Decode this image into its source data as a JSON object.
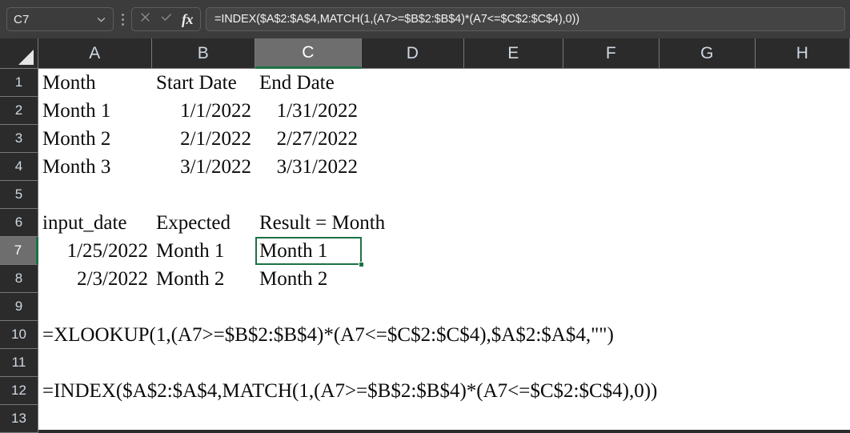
{
  "toolbar": {
    "name_box_value": "C7",
    "name_box_icon": "chevron-down-icon",
    "overflow_icon": "kebab-menu-icon",
    "cancel_icon": "close-icon",
    "accept_icon": "check-icon",
    "function_icon": "fx-icon",
    "function_icon_label": "fx",
    "formula_value": "=INDEX($A$2:$A$4,MATCH(1,(A7>=$B$2:$B$4)*(A7<=$C$2:$C$4),0))"
  },
  "grid": {
    "active_column": "C",
    "active_row": "7",
    "selected_cell": "C7",
    "accent_color": "#1e7145",
    "header_background": "#2b2b2b",
    "header_active_background": "#6e6e6e",
    "sheet_background": "#ffffff",
    "columns": [
      "A",
      "B",
      "C",
      "D",
      "E",
      "F",
      "G",
      "H"
    ],
    "rows": [
      "1",
      "2",
      "3",
      "4",
      "5",
      "6",
      "7",
      "8",
      "9",
      "10",
      "11",
      "12",
      "13"
    ]
  },
  "cells": {
    "A1": "Month",
    "B1": "Start Date",
    "C1": "End Date",
    "A2": "Month 1",
    "B2": "1/1/2022",
    "C2": "1/31/2022",
    "A3": "Month 2",
    "B3": "2/1/2022",
    "C3": "2/27/2022",
    "A4": "Month 3",
    "B4": "3/1/2022",
    "C4": "3/31/2022",
    "A6": "input_date",
    "B6": "Expected",
    "C6": "Result = Month",
    "A7": "1/25/2022",
    "B7": "Month 1",
    "C7": "Month 1",
    "A8": "2/3/2022",
    "B8": "Month 2",
    "C8": "Month 2",
    "A10": "=XLOOKUP(1,(A7>=$B$2:$B$4)*(A7<=$C$2:$C$4),$A$2:$A$4,\"\")",
    "A12": "=INDEX($A$2:$A$4,MATCH(1,(A7>=$B$2:$B$4)*(A7<=$C$2:$C$4),0))"
  }
}
